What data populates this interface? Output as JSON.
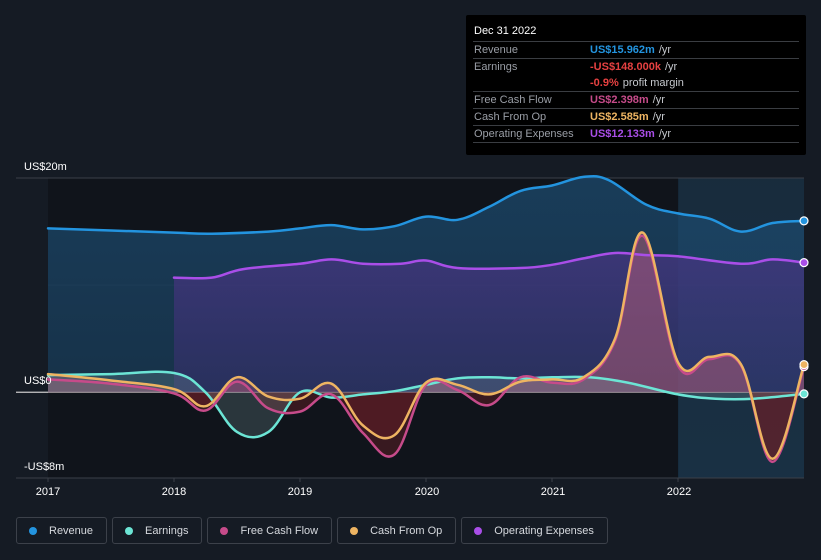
{
  "tooltip": {
    "date": "Dec 31 2022",
    "rows": [
      {
        "label": "Revenue",
        "value": "US$15.962m",
        "suffix": "/yr",
        "color": "#2394df"
      },
      {
        "label": "Earnings",
        "value": "-US$148.000k",
        "suffix": "/yr",
        "color": "#e64141"
      },
      {
        "label": "",
        "value": "-0.9%",
        "suffix": "profit margin",
        "color": "#e64141"
      },
      {
        "label": "Free Cash Flow",
        "value": "US$2.398m",
        "suffix": "/yr",
        "color": "#c64b8a"
      },
      {
        "label": "Cash From Op",
        "value": "US$2.585m",
        "suffix": "/yr",
        "color": "#eeb462"
      },
      {
        "label": "Operating Expenses",
        "value": "US$12.133m",
        "suffix": "/yr",
        "color": "#a94ee8"
      }
    ]
  },
  "legend": [
    {
      "label": "Revenue",
      "color": "#2394df"
    },
    {
      "label": "Earnings",
      "color": "#6ce5d5"
    },
    {
      "label": "Free Cash Flow",
      "color": "#c64b8a"
    },
    {
      "label": "Cash From Op",
      "color": "#eeb462"
    },
    {
      "label": "Operating Expenses",
      "color": "#a94ee8"
    }
  ],
  "chart_data": {
    "type": "area",
    "title": "",
    "xlabel": "",
    "ylabel": "",
    "ylim": [
      -8,
      20
    ],
    "xlim": [
      2017,
      2023
    ],
    "y_tick_labels": [
      {
        "value": 20,
        "label": "US$20m"
      },
      {
        "value": 0,
        "label": "US$0"
      },
      {
        "value": -8,
        "label": "-US$8m"
      }
    ],
    "x_tick_labels": [
      {
        "value": 2017,
        "label": "2017"
      },
      {
        "value": 2018,
        "label": "2018"
      },
      {
        "value": 2019,
        "label": "2019"
      },
      {
        "value": 2020,
        "label": "2020"
      },
      {
        "value": 2021,
        "label": "2021"
      },
      {
        "value": 2022,
        "label": "2022"
      }
    ],
    "highlight_from": 2022,
    "units": "US$ millions",
    "series": [
      {
        "name": "Revenue",
        "color": "#2394df",
        "x": [
          2017,
          2017.5,
          2018,
          2018.3,
          2018.75,
          2019,
          2019.25,
          2019.5,
          2019.75,
          2020,
          2020.25,
          2020.5,
          2020.75,
          2021,
          2021.25,
          2021.45,
          2021.75,
          2022,
          2022.25,
          2022.5,
          2022.75,
          2023
        ],
        "values": [
          15.3,
          15.1,
          14.9,
          14.8,
          15.0,
          15.3,
          15.6,
          15.2,
          15.5,
          16.4,
          16.1,
          17.3,
          18.8,
          19.3,
          20.1,
          19.8,
          17.5,
          16.7,
          16.2,
          15.0,
          15.8,
          16.0
        ]
      },
      {
        "name": "Operating Expenses",
        "color": "#a94ee8",
        "x": [
          2018,
          2018.3,
          2018.55,
          2019,
          2019.25,
          2019.5,
          2019.8,
          2020,
          2020.25,
          2020.75,
          2021,
          2021.25,
          2021.5,
          2021.75,
          2022,
          2022.5,
          2022.75,
          2023
        ],
        "values": [
          10.7,
          10.7,
          11.5,
          12.0,
          12.4,
          12.0,
          12.0,
          12.3,
          11.6,
          11.6,
          11.9,
          12.5,
          13.0,
          12.8,
          12.7,
          12.0,
          12.4,
          12.1
        ]
      },
      {
        "name": "Earnings",
        "color": "#6ce5d5",
        "x": [
          2017,
          2017.5,
          2018,
          2018.25,
          2018.5,
          2018.75,
          2019,
          2019.25,
          2019.5,
          2019.75,
          2020,
          2020.25,
          2020.5,
          2020.75,
          2021,
          2021.3,
          2021.6,
          2022,
          2022.3,
          2022.6,
          2023
        ],
        "values": [
          1.6,
          1.7,
          1.8,
          0.0,
          -3.7,
          -3.7,
          0.0,
          -0.5,
          -0.2,
          0.1,
          0.7,
          1.3,
          1.4,
          1.3,
          1.4,
          1.4,
          0.9,
          -0.2,
          -0.6,
          -0.6,
          -0.148
        ]
      },
      {
        "name": "Free Cash Flow",
        "color": "#c64b8a",
        "x": [
          2017,
          2017.5,
          2018,
          2018.25,
          2018.5,
          2018.75,
          2019,
          2019.25,
          2019.5,
          2019.75,
          2020,
          2020.25,
          2020.5,
          2020.75,
          2021,
          2021.25,
          2021.5,
          2021.72,
          2022,
          2022.25,
          2022.5,
          2022.75,
          2023
        ],
        "values": [
          1.2,
          0.8,
          -0.1,
          -1.7,
          1.0,
          -1.5,
          -1.8,
          -0.2,
          -3.8,
          -5.8,
          0.7,
          0.2,
          -1.2,
          1.4,
          0.9,
          1.2,
          4.8,
          14.6,
          2.5,
          3.1,
          2.5,
          -6.5,
          2.398
        ]
      },
      {
        "name": "Cash From Op",
        "color": "#eeb462",
        "x": [
          2017,
          2017.5,
          2018,
          2018.25,
          2018.5,
          2018.75,
          2019,
          2019.25,
          2019.5,
          2019.75,
          2020,
          2020.25,
          2020.5,
          2020.75,
          2021,
          2021.25,
          2021.5,
          2021.72,
          2022,
          2022.25,
          2022.5,
          2022.75,
          2023
        ],
        "values": [
          1.7,
          1.1,
          0.3,
          -1.3,
          1.4,
          -0.4,
          -0.6,
          0.8,
          -3.1,
          -4.0,
          0.9,
          0.7,
          -0.2,
          1.0,
          1.2,
          1.4,
          5.0,
          14.9,
          2.8,
          3.3,
          2.6,
          -6.2,
          2.585
        ]
      }
    ]
  }
}
